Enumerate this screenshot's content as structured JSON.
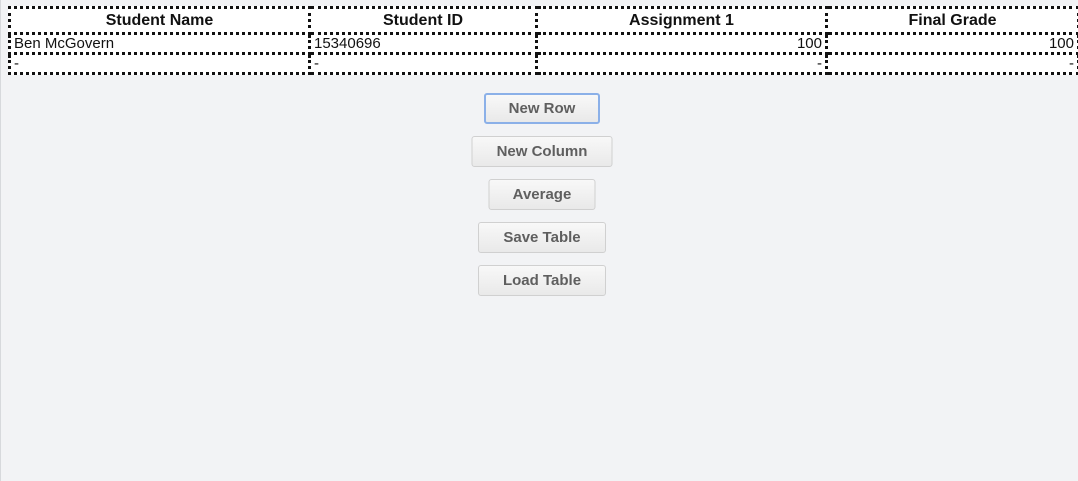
{
  "table": {
    "headers": [
      "Student Name",
      "Student ID",
      "Assignment 1",
      "Final Grade"
    ],
    "rows": [
      [
        "Ben McGovern",
        "15340696",
        "100",
        "100"
      ],
      [
        "-",
        "-",
        "-",
        "-"
      ]
    ]
  },
  "buttons": {
    "new_row": "New Row",
    "new_column": "New Column",
    "average": "Average",
    "save_table": "Save Table",
    "load_table": "Load Table"
  }
}
